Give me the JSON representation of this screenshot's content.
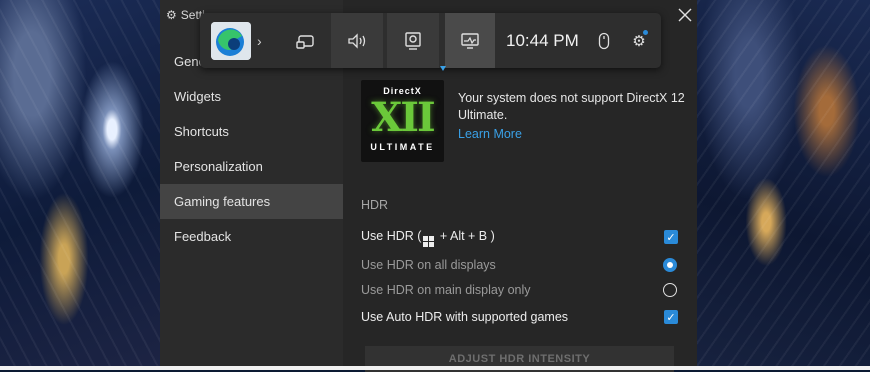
{
  "window": {
    "title": "Setti"
  },
  "gamebar": {
    "clock": "10:44 PM",
    "widgets": [
      "edge-logo",
      "capture-icon",
      "audio-icon",
      "webcam-icon",
      "performance-icon",
      "mouse-icon",
      "gear-icon"
    ]
  },
  "sidebar": {
    "items": [
      {
        "label": "Gene"
      },
      {
        "label": "Widgets"
      },
      {
        "label": "Shortcuts"
      },
      {
        "label": "Personalization"
      },
      {
        "label": "Gaming features"
      },
      {
        "label": "Feedback"
      }
    ],
    "selected": "Gaming features"
  },
  "directx": {
    "logo_top": "DirectX",
    "logo_xii": "XII",
    "logo_bottom": "ULTIMATE",
    "message": "Your system does not support DirectX 12 Ultimate.",
    "link": "Learn More"
  },
  "hdr": {
    "heading": "HDR",
    "use_hdr_prefix": "Use HDR (",
    "use_hdr_suffix": " + Alt + B )",
    "use_hdr_checked": true,
    "all_displays": "Use HDR on all displays",
    "all_displays_selected": true,
    "main_display": "Use HDR on main display only",
    "main_display_selected": false,
    "auto_hdr": "Use Auto HDR with supported games",
    "auto_hdr_checked": true,
    "adjust_button": "ADJUST HDR INTENSITY"
  },
  "colors": {
    "accent": "#2a8ad8",
    "link": "#3aa0e6",
    "directx_green": "#6bc83a",
    "panel": "#262626",
    "sidebar": "#2b2b2b",
    "selected": "#444444"
  }
}
